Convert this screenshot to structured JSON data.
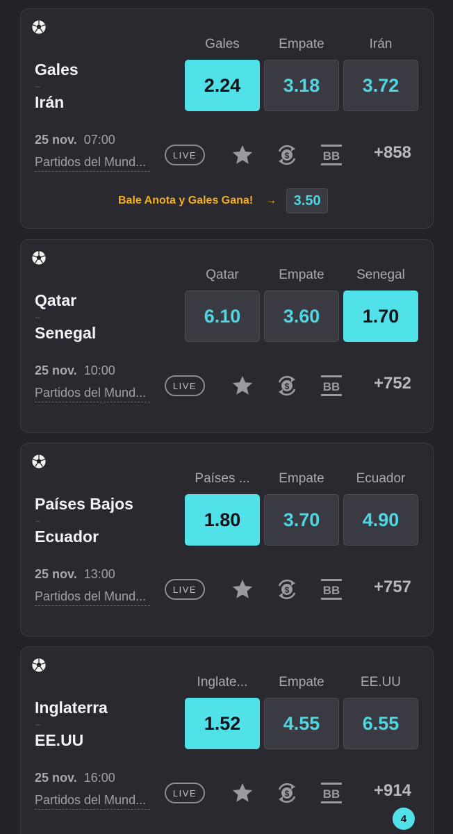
{
  "matches": [
    {
      "team1": "Gales",
      "team2": "Irán",
      "separator": "–",
      "labels": [
        "Gales",
        "Empate",
        "Irán"
      ],
      "odds": [
        "2.24",
        "3.18",
        "3.72"
      ],
      "selected_index": 0,
      "date": "25 nov.",
      "time": "07:00",
      "league": "Partidos del Mund...",
      "live": "LIVE",
      "more": "+858",
      "promo": {
        "text": "Bale Anota y Gales Gana!",
        "arrow": "→",
        "odd": "3.50"
      }
    },
    {
      "team1": "Qatar",
      "team2": "Senegal",
      "separator": "–",
      "labels": [
        "Qatar",
        "Empate",
        "Senegal"
      ],
      "odds": [
        "6.10",
        "3.60",
        "1.70"
      ],
      "selected_index": 2,
      "date": "25 nov.",
      "time": "10:00",
      "league": "Partidos del Mund...",
      "live": "LIVE",
      "more": "+752"
    },
    {
      "team1": "Países Bajos",
      "team2": "Ecuador",
      "separator": "–",
      "labels": [
        "Países ...",
        "Empate",
        "Ecuador"
      ],
      "odds": [
        "1.80",
        "3.70",
        "4.90"
      ],
      "selected_index": 0,
      "date": "25 nov.",
      "time": "13:00",
      "league": "Partidos del Mund...",
      "live": "LIVE",
      "more": "+757"
    },
    {
      "team1": "Inglaterra",
      "team2": "EE.UU",
      "separator": "–",
      "labels": [
        "Inglate...",
        "Empate",
        "EE.UU"
      ],
      "odds": [
        "1.52",
        "4.55",
        "6.55"
      ],
      "selected_index": 0,
      "date": "25 nov.",
      "time": "16:00",
      "league": "Partidos del Mund...",
      "live": "LIVE",
      "more": "+914"
    }
  ],
  "betslip_count": "4",
  "icons": {
    "sport": "soccer-ball-icon",
    "favorite": "star-icon",
    "cashout": "cashout-icon",
    "bet_builder": "bet-builder-icon"
  },
  "colors": {
    "accent": "#50e1e9",
    "odd_text": "#4fd6e2",
    "promo": "#f2b01e",
    "card": "#29292f",
    "background": "#222227"
  }
}
